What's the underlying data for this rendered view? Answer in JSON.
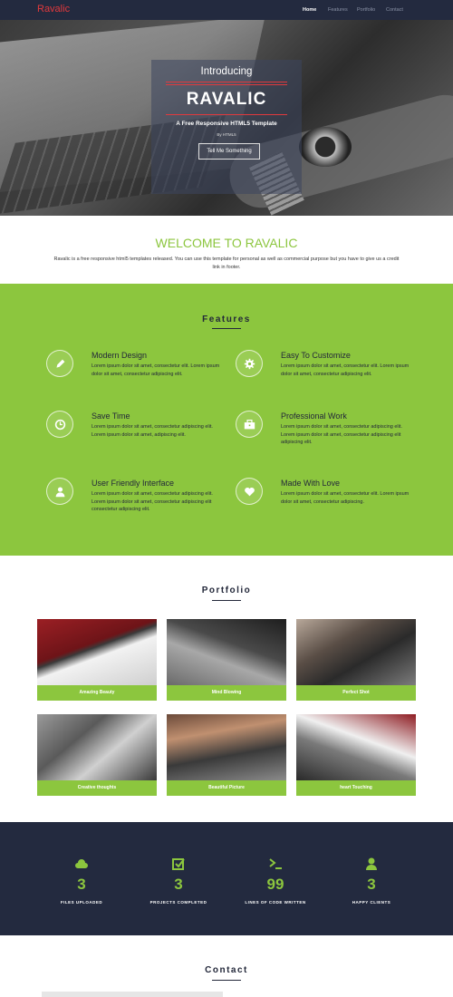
{
  "nav": {
    "brand": "Ravalic",
    "links": [
      "Home",
      "Features",
      "Portfolio",
      "Contact"
    ],
    "colors": {
      "bg": "#232a3f",
      "brand": "#e2393d"
    }
  },
  "hero": {
    "intro": "Introducing",
    "title": "RAVALIC",
    "subtitle": "A Free Responsive HTML5 Template",
    "by": "By HTML5",
    "button": "Tell Me Something"
  },
  "welcome": {
    "title": "WELCOME TO RAVALIC",
    "text": "Ravalic is a free responsive html5 templates released. You can use this template for personal as well as commercial purpose but you have to give us a credit link in footer."
  },
  "features": {
    "title": "Features",
    "accent": "#8cc63e",
    "items": [
      {
        "title": "Modern Design",
        "icon": "pencil-icon",
        "text": "Lorem ipsum dolor sit amet, consectetur elit. Lorem ipsum dolor sit amet, consectetur adipiscing elit."
      },
      {
        "title": "Easy To Customize",
        "icon": "gear-icon",
        "text": "Lorem ipsum dolor sit amet, consectetur elit. Lorem ipsum dolor sit amet, consectetur adipiscing elit."
      },
      {
        "title": "Save Time",
        "icon": "clock-icon",
        "text": "Lorem ipsum dolor sit amet, consectetur adipiscing elit. Lorem ipsum dolor sit amet, adipiscing elit."
      },
      {
        "title": "Professional Work",
        "icon": "briefcase-icon",
        "text": "Lorem ipsum dolor sit amet, consectetur adipiscing elit. Lorem ipsum dolor sit amet, consectetur adipiscing elit adipiscing elit."
      },
      {
        "title": "User Friendly Interface",
        "icon": "user-icon",
        "text": "Lorem ipsum dolor sit amet, consectetur adipiscing elit. Lorem ipsum dolor sit amet, consectetur adipiscing elit consectetur adipiscing elit."
      },
      {
        "title": "Made With Love",
        "icon": "heart-icon",
        "text": "Lorem ipsum dolor sit amet, consectetur elit. Lorem ipsum dolor sit amet, consectetur adipiscing."
      }
    ]
  },
  "portfolio": {
    "title": "Portfolio",
    "items": [
      "Amazing Beauty",
      "Mind Blowing",
      "Perfect Shot",
      "Creative thoughts",
      "Beautiful Picture",
      "heart Touching"
    ]
  },
  "stats": [
    {
      "icon": "cloud-icon",
      "value": "3",
      "label": "FILES UPLOADED"
    },
    {
      "icon": "checkbox-icon",
      "value": "3",
      "label": "PROJECTS COMPLETED"
    },
    {
      "icon": "terminal-icon",
      "value": "99",
      "label": "LINES OF CODE WRITTEN"
    },
    {
      "icon": "person-icon",
      "value": "3",
      "label": "HAPPY CLIENTS"
    }
  ],
  "contact": {
    "title": "Contact"
  }
}
